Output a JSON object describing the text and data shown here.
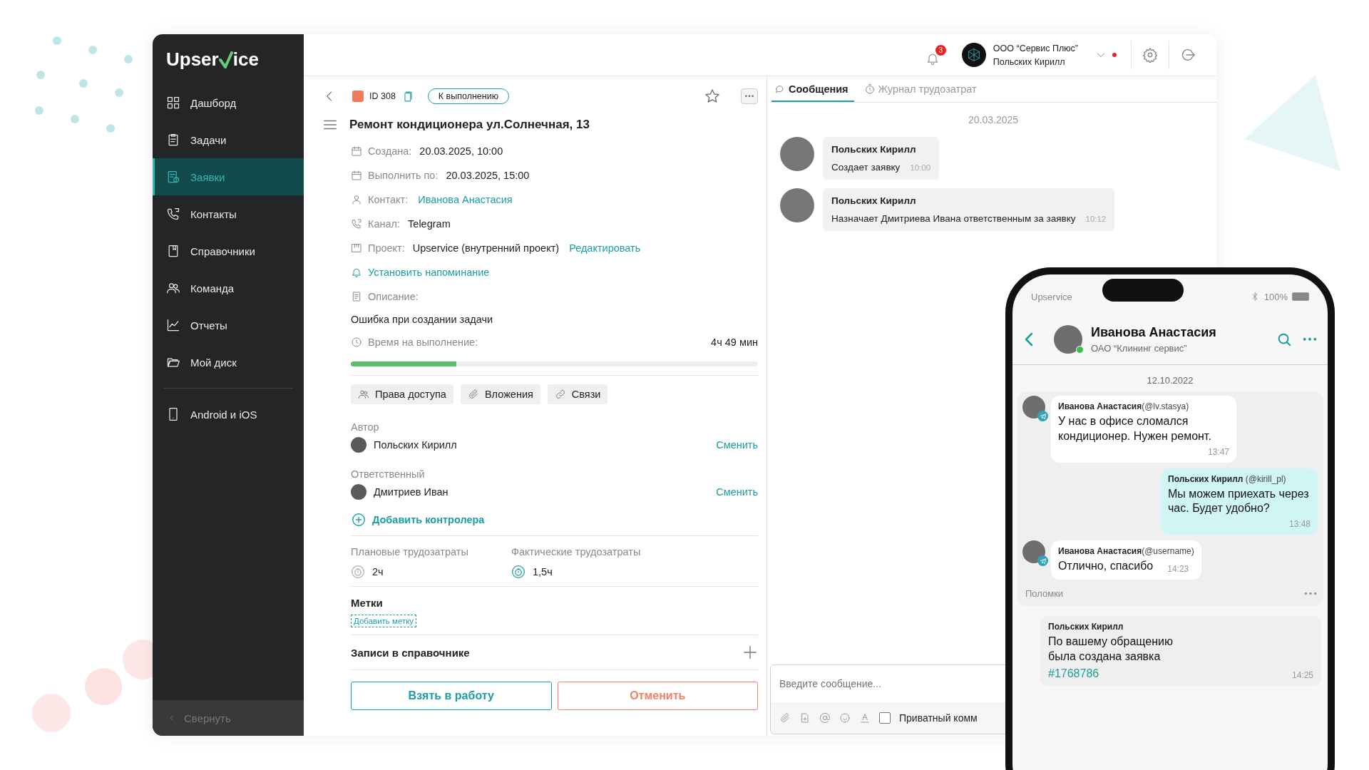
{
  "sidebar": {
    "logo_start": "Upser",
    "logo_end": "ice",
    "items": [
      {
        "label": "Дашборд",
        "selected": false
      },
      {
        "label": "Задачи",
        "selected": false
      },
      {
        "label": "Заявки",
        "selected": true
      },
      {
        "label": "Контакты",
        "selected": false
      },
      {
        "label": "Справочники",
        "selected": false
      },
      {
        "label": "Команда",
        "selected": false
      },
      {
        "label": "Отчеты",
        "selected": false
      },
      {
        "label": "Мой диск",
        "selected": false
      }
    ],
    "mobile_item": {
      "label": "Android и iOS",
      "selected": false
    },
    "collapse": "Свернуть"
  },
  "header": {
    "notifications": "3",
    "company": "ООО “Сервис Плюс”",
    "user": "Польских Кирилл"
  },
  "ticket": {
    "id": "ID 308",
    "status": "К выполнению",
    "title": "Ремонт кондиционера ул.Солнечная, 13",
    "fields": [
      {
        "label": "Создана:",
        "value": "20.03.2025, 10:00"
      },
      {
        "label": "Выполнить по:",
        "value": "20.03.2025, 15:00"
      },
      {
        "label": "Контакт:",
        "link": "Иванова Анастасия"
      },
      {
        "label": "Канал:",
        "value": "Telegram"
      },
      {
        "label": "Проект:",
        "value": "Upservice (внутренний проект)",
        "link": "Редактировать"
      }
    ],
    "reminder": "Установить напоминание",
    "description_label": "Описание:",
    "description": "Ошибка при создании задачи",
    "time_label": "Время на выполнение:",
    "time_left": "4ч 49 мин",
    "level": 0.26,
    "chips": [
      {
        "label": "Права доступа"
      },
      {
        "label": "Вложения"
      },
      {
        "label": "Связи"
      }
    ],
    "people": [
      {
        "role": "Автор",
        "name": "Польских Кирилл",
        "action": "Сменить"
      },
      {
        "role": "Ответственный",
        "name": "Дмитриев Иван",
        "action": "Сменить"
      }
    ],
    "add_controller": "Добавить контролера",
    "efforts": [
      {
        "label": "Плановые трудозатраты",
        "value": "2ч",
        "active": false
      },
      {
        "label": "Фактические трудозатраты",
        "value": "1,5ч",
        "active": true
      }
    ],
    "tags_title": "Метки",
    "add_tag": "Добавить метку",
    "directory": "Записи в справочнике",
    "buttons": [
      {
        "kind": "primary",
        "label": "Взять в работу"
      },
      {
        "kind": "danger",
        "label": "Отменить"
      }
    ]
  },
  "chat": {
    "tabs": [
      {
        "label": "Сообщения",
        "selected": true
      },
      {
        "label": "Журнал трудозатрат",
        "selected": false
      }
    ],
    "date": "20.03.2025",
    "messages": [
      {
        "author": "Польских Кирилл",
        "text": "Создает заявку",
        "time": "10:00"
      },
      {
        "author": "Польских Кирилл",
        "text": "Назначает Дмитриева Ивана ответственным за заявку",
        "time": "10:12"
      }
    ],
    "placeholder": "Введите сообщение...",
    "private_label": "Приватный комм",
    "private_checked": false
  },
  "phone": {
    "app": "Upservice",
    "battery": "100%",
    "contact": "Иванова Анастасия",
    "company": "ОАО “Клининг сервис”",
    "online": true,
    "date": "12.10.2022",
    "messages": [
      {
        "kind": "incoming",
        "sender": "**Иванова Анастасия**(@lv.stasya)",
        "text": "У нас в офисе сломался кондиционер. Нужен ремонт.",
        "time": "13:47"
      },
      {
        "kind": "outgoing",
        "sender": "**Польских Кирилл** (@kirill_pl)",
        "text": "Мы можем приехать через час. Будет удобно?",
        "time": "13:48"
      },
      {
        "kind": "incoming",
        "sender": "**Иванова Анастасия**(@username)",
        "text": "Отлично, спасибо",
        "time": "14:23"
      }
    ],
    "group_label": "Поломки",
    "note": {
      "author": "Польских Кирилл",
      "text": "По вашему обращению была создана заявка",
      "link": "#1768786",
      "time": "14:25"
    }
  }
}
